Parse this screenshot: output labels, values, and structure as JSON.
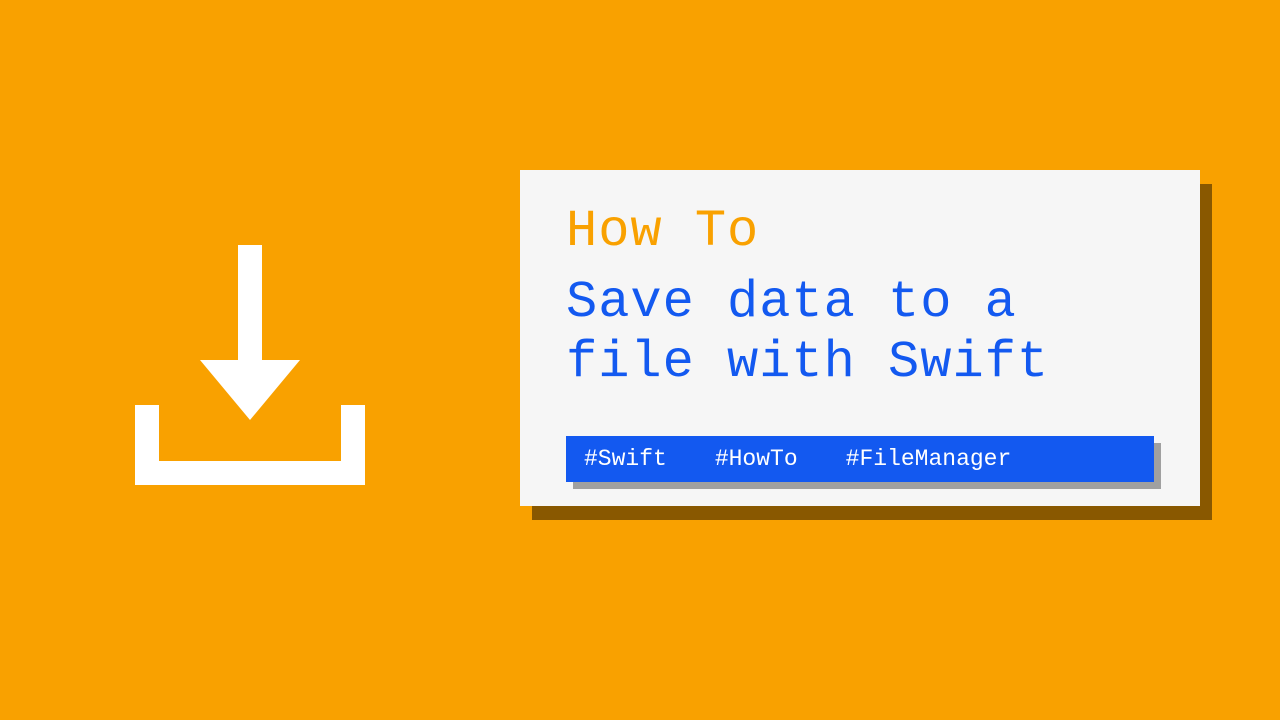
{
  "eyebrow": "How To",
  "title": "Save data to a file with Swift",
  "tags": [
    "#Swift",
    "#HowTo",
    "#FileManager"
  ],
  "colors": {
    "background": "#F9A100",
    "card": "#F6F6F6",
    "accent": "#1359F0",
    "icon": "#FFFFFF"
  }
}
